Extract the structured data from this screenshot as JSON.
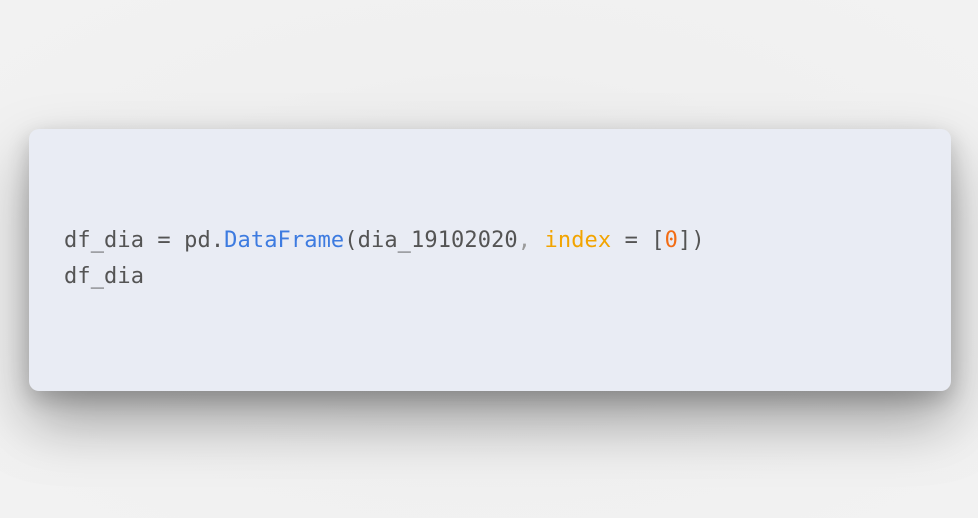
{
  "code": {
    "line1": {
      "lhs": "df_dia",
      "assign": " = ",
      "obj": "pd.",
      "func": "DataFrame",
      "open_paren": "(",
      "arg": "dia_19102020",
      "comma": ",",
      "space": " ",
      "kwarg": "index",
      "kw_assign": " = ",
      "open_bracket": "[",
      "num": "0",
      "close": "])"
    },
    "line2": {
      "text": "df_dia"
    }
  },
  "colors": {
    "card_background": "#e9ecf4",
    "text": "#545454",
    "function": "#3d7be0",
    "keyword_arg": "#f2a400",
    "number": "#f26c14"
  }
}
